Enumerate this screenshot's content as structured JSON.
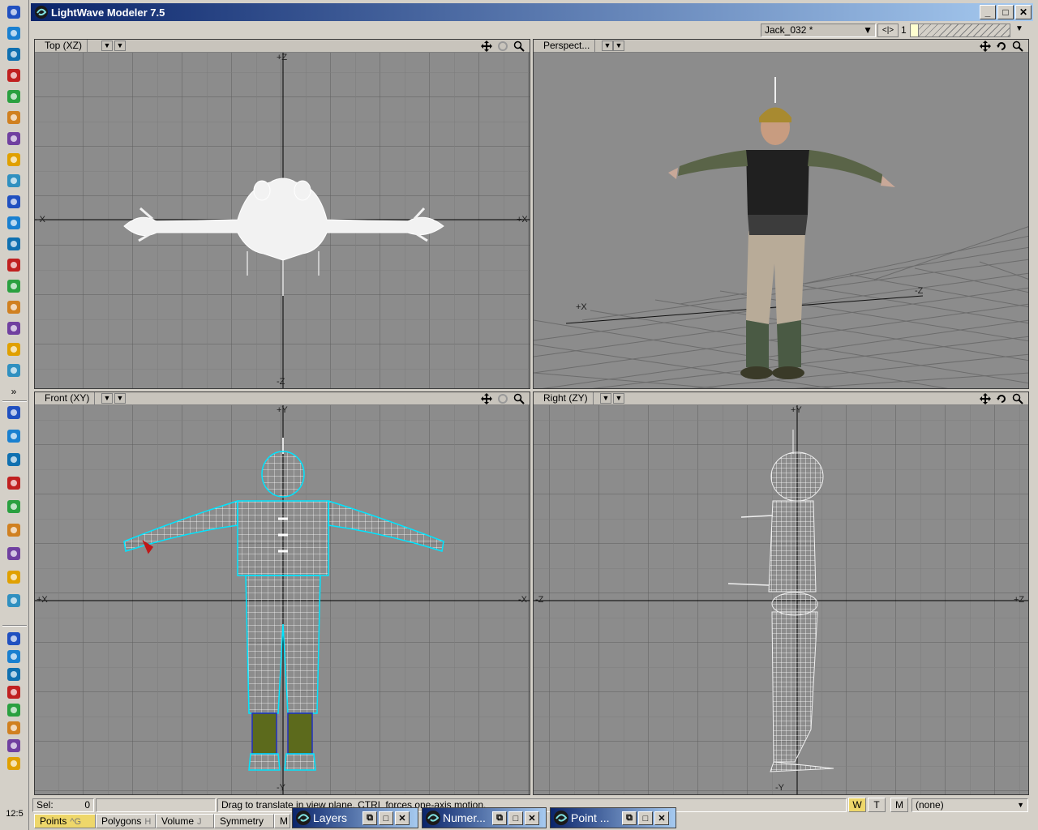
{
  "window": {
    "title": "LightWave Modeler 7.5",
    "buttons": {
      "min": "_",
      "max": "□",
      "close": "✕"
    }
  },
  "taskbar": {
    "clock": "12:5",
    "chevron": "»",
    "icons": [
      "windows-start-icon",
      "globe-icon",
      "internet-explorer-icon",
      "quicktime-icon",
      "internet-explorer-icon",
      "figure-icon",
      "image-icon",
      "document-icon",
      "paint-icon",
      "red-ball-icon",
      "red-bug-icon",
      "m-logo-icon",
      "lightwave-icon",
      "lightwave-icon",
      "film-icon",
      "cd-icon",
      "runner-icon",
      "lightwave-icon",
      "lightwave-icon",
      "cube-icon",
      "internet-explorer-icon",
      "internet-explorer-icon",
      "internet-explorer-icon",
      "internet-explorer-icon",
      "quicktime-icon",
      "disk-icon",
      "globe-icon",
      "folder-icon",
      "runner-icon",
      "mouse-icon",
      "lightwave-icon",
      "search-icon",
      "speaker-icon",
      "network-icon",
      "printer-icon"
    ]
  },
  "toolbar": {
    "layer_name": "Jack_032 *",
    "layer_nav": "<|>",
    "layer_number": "1"
  },
  "viewports": {
    "top": {
      "title": "Top   (XZ)",
      "labels": {
        "pz": "+Z",
        "nz": "-Z",
        "px": "+X",
        "nx": "-X"
      }
    },
    "perspective": {
      "title": "Perspect...",
      "labels": {
        "px": "+X",
        "nz": "-Z"
      }
    },
    "front": {
      "title": "Front  (XY)",
      "labels": {
        "py": "+Y",
        "ny": "-Y",
        "px": "+X",
        "nx": "-X"
      }
    },
    "right": {
      "title": "Right  (ZY)",
      "labels": {
        "py": "+Y",
        "ny": "-Y",
        "nz": "-Z",
        "pz": "+Z"
      }
    }
  },
  "status": {
    "sel_label": "Sel:",
    "sel_value": "0",
    "hint": "Drag to translate in view plane. CTRL forces one-axis motion.",
    "wtm": [
      "W",
      "T",
      "M"
    ],
    "surface": "(none)"
  },
  "modes": [
    {
      "label": "Points",
      "key": "^G",
      "active": true
    },
    {
      "label": "Polygons",
      "key": "H",
      "active": false
    },
    {
      "label": "Volume",
      "key": "J",
      "active": false
    },
    {
      "label": "Symmetry",
      "key": "",
      "active": false
    },
    {
      "label": "M",
      "key": "",
      "active": false
    }
  ],
  "floaters": [
    {
      "title": "Layers"
    },
    {
      "title": "Numer..."
    },
    {
      "title": "Point ..."
    }
  ],
  "colors": {
    "viewport_bg": "#8c8c8c",
    "grid": "#5a5a5a",
    "mesh_white": "#f0f0f0",
    "mesh_selected": "#00e5ff",
    "mode_active": "#eed76a",
    "titlebar_dark": "#0a246a"
  }
}
